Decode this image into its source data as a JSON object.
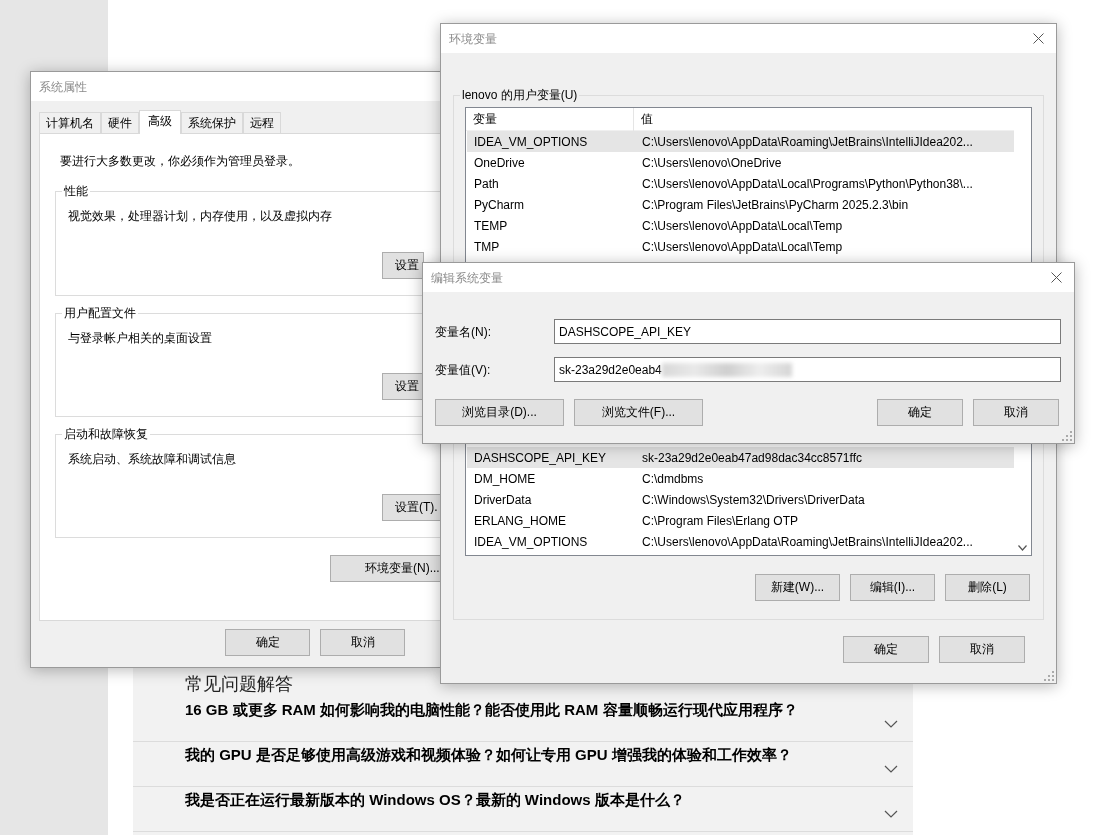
{
  "faq": {
    "title": "常见问题解答",
    "items": [
      {
        "question": "16 GB 或更多 RAM 如何影响我的电脑性能？能否使用此 RAM 容量顺畅运行现代应用程序？",
        "expanded": false
      },
      {
        "question": "我的 GPU 是否足够使用高级游戏和视频体验？如何让专用 GPU 增强我的体验和工作效率？",
        "expanded": false
      },
      {
        "question": "我是否正在运行最新版本的 Windows OS？最新的 Windows 版本是什么？",
        "expanded": false
      }
    ]
  },
  "system_properties": {
    "title": "系统属性",
    "tabs": [
      {
        "label": "计算机名",
        "selected": false
      },
      {
        "label": "硬件",
        "selected": false
      },
      {
        "label": "高级",
        "selected": true
      },
      {
        "label": "系统保护",
        "selected": false
      },
      {
        "label": "远程",
        "selected": false
      }
    ],
    "notice": "要进行大多数更改，你必须作为管理员登录。",
    "groups": [
      {
        "title": "性能",
        "description": "视觉效果，处理器计划，内存使用，以及虚拟内存",
        "button": "设置"
      },
      {
        "title": "用户配置文件",
        "description": "与登录帐户相关的桌面设置",
        "button": "设置"
      },
      {
        "title": "启动和故障恢复",
        "description": "系统启动、系统故障和调试信息",
        "button": "设置(T)."
      }
    ],
    "env_button": "环境变量(N)...",
    "buttons": [
      "确定",
      "取消"
    ]
  },
  "environment_variables": {
    "title": "环境变量",
    "user_group_title": "lenovo 的用户变量(U)",
    "columns": [
      "变量",
      "值"
    ],
    "user_rows": [
      {
        "name": "IDEA_VM_OPTIONS",
        "value": "C:\\Users\\lenovo\\AppData\\Roaming\\JetBrains\\IntelliJIdea202...",
        "selected": true
      },
      {
        "name": "OneDrive",
        "value": "C:\\Users\\lenovo\\OneDrive",
        "selected": false
      },
      {
        "name": "Path",
        "value": "C:\\Users\\lenovo\\AppData\\Local\\Programs\\Python\\Python38\\...",
        "selected": false
      },
      {
        "name": "PyCharm",
        "value": "C:\\Program Files\\JetBrains\\PyCharm 2025.2.3\\bin",
        "selected": false
      },
      {
        "name": "TEMP",
        "value": "C:\\Users\\lenovo\\AppData\\Local\\Temp",
        "selected": false
      },
      {
        "name": "TMP",
        "value": "C:\\Users\\lenovo\\AppData\\Local\\Temp",
        "selected": false
      }
    ],
    "system_rows": [
      {
        "name": "DASHSCOPE_API_KEY",
        "value": "sk-23a29d2e0eab47ad98dac34cc8571ffc",
        "selected": true
      },
      {
        "name": "DM_HOME",
        "value": "C:\\dmdbms",
        "selected": false
      },
      {
        "name": "DriverData",
        "value": "C:\\Windows\\System32\\Drivers\\DriverData",
        "selected": false
      },
      {
        "name": "ERLANG_HOME",
        "value": "C:\\Program Files\\Erlang OTP",
        "selected": false
      },
      {
        "name": "IDEA_VM_OPTIONS",
        "value": "C:\\Users\\lenovo\\AppData\\Roaming\\JetBrains\\IntelliJIdea202...",
        "selected": false
      }
    ],
    "system_buttons": [
      "新建(W)...",
      "编辑(I)...",
      "删除(L)"
    ],
    "buttons": [
      "确定",
      "取消"
    ]
  },
  "edit_dialog": {
    "title": "编辑系统变量",
    "fields": [
      {
        "label": "变量名(N):",
        "value": "DASHSCOPE_API_KEY",
        "redacted": false
      },
      {
        "label": "变量值(V):",
        "value": "sk-23a29d2e0eab4",
        "redacted": true
      }
    ],
    "browse_buttons": [
      "浏览目录(D)...",
      "浏览文件(F)..."
    ],
    "buttons": [
      "确定",
      "取消"
    ]
  }
}
